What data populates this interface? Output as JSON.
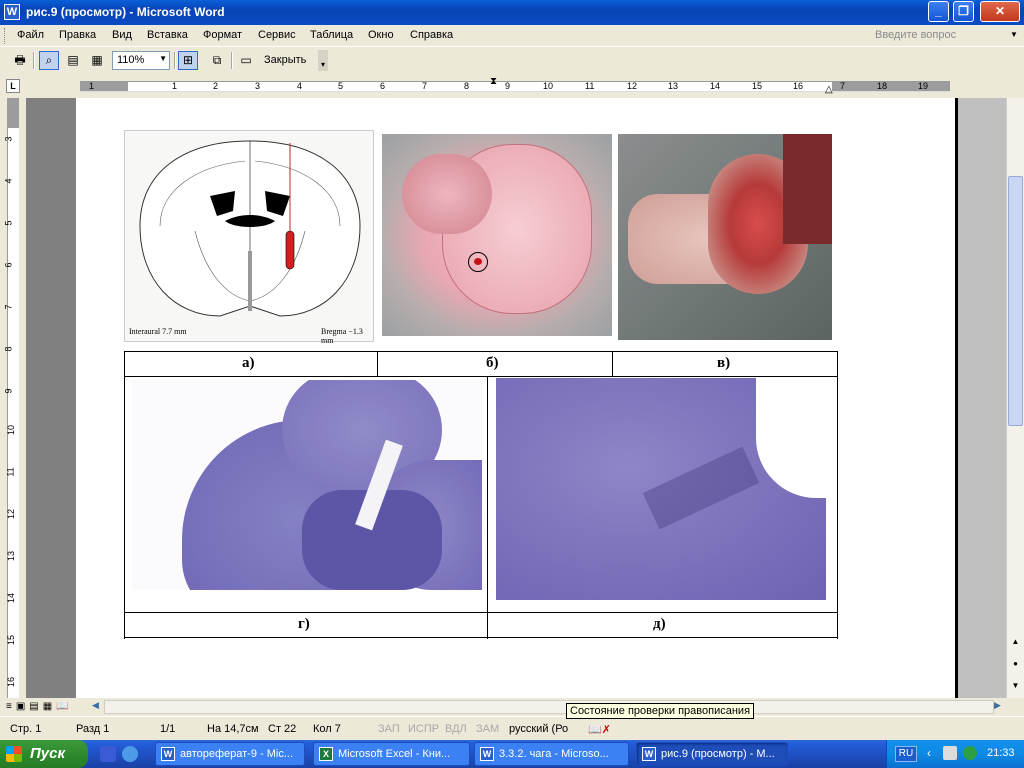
{
  "window": {
    "title": "рис.9 (просмотр) - Microsoft Word",
    "app_icon": "W"
  },
  "menu": {
    "items": [
      "Файл",
      "Правка",
      "Вид",
      "Вставка",
      "Формат",
      "Сервис",
      "Таблица",
      "Окно",
      "Справка"
    ],
    "ask_placeholder": "Введите вопрос"
  },
  "toolbar": {
    "zoom": "110%",
    "close_label": "Закрыть"
  },
  "ruler": {
    "h_numbers": [
      "1",
      "1",
      "2",
      "3",
      "4",
      "5",
      "6",
      "7",
      "8",
      "9",
      "10",
      "11",
      "12",
      "13",
      "14",
      "15",
      "16",
      "7",
      "18",
      "19"
    ],
    "v_numbers": [
      "3",
      "4",
      "5",
      "6",
      "7",
      "8",
      "9",
      "10",
      "11",
      "12",
      "13",
      "14",
      "15",
      "16"
    ]
  },
  "figure": {
    "labels": [
      "а)",
      "б)",
      "в)",
      "г)",
      "д)"
    ],
    "atlas_text_left": "Interaural 7.7 mm",
    "atlas_text_right": "Bregma −1.3 mm"
  },
  "statusbar": {
    "page": "Стр.  1",
    "section": "Разд  1",
    "pages": "1/1",
    "at": "На  14,7см",
    "line": "Ст  22",
    "col": "Кол  7",
    "rec": "ЗАП",
    "trk": "ИСПР",
    "ext": "ВДЛ",
    "ovr": "ЗАМ",
    "lang": "русский (Ро"
  },
  "tooltip": "Состояние проверки правописания",
  "taskbar": {
    "start": "Пуск",
    "tasks": [
      {
        "label": "автореферат-9 - Mic...",
        "icon": "W",
        "active": false
      },
      {
        "label": "Microsoft Excel - Кни...",
        "icon": "X",
        "active": false
      },
      {
        "label": "3.3.2. чага - Microso...",
        "icon": "W",
        "active": false
      },
      {
        "label": "рис.9 (просмотр) - M...",
        "icon": "W",
        "active": true
      }
    ],
    "lang": "RU",
    "clock": "21:33"
  },
  "colors": {
    "xp_blue": "#0843b5",
    "start_green": "#2d8a2d",
    "stain": "#6f66b5"
  }
}
